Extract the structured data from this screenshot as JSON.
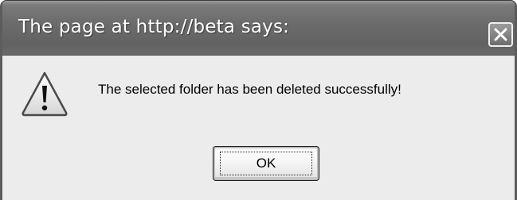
{
  "dialog": {
    "title": "The page at http://beta says:",
    "message": "The selected folder has been deleted successfully!",
    "ok_label": "OK",
    "icon": "warning-icon",
    "close_icon": "close-icon"
  },
  "colors": {
    "titlebar": "#6c6c6c",
    "body_background": "#ececec",
    "title_text": "#ffffff",
    "message_text": "#000000"
  }
}
